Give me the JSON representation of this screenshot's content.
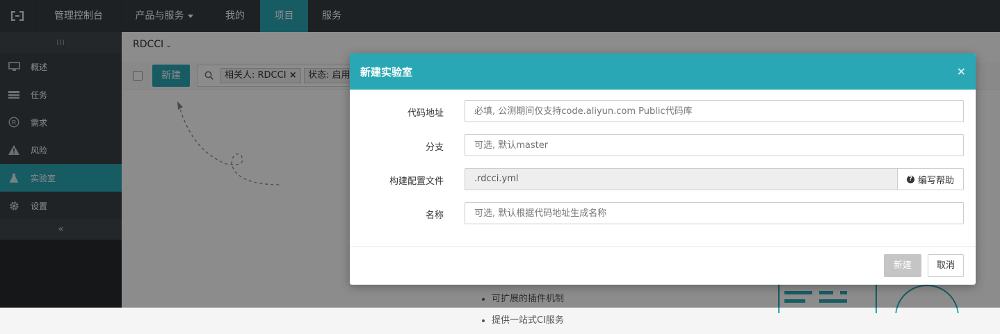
{
  "topnav": {
    "console": "管理控制台",
    "products": "产品与服务",
    "mine": "我的",
    "project": "项目",
    "service": "服务"
  },
  "sidebar": {
    "toggle": "III",
    "items": [
      {
        "label": "概述",
        "icon": "monitor-icon"
      },
      {
        "label": "任务",
        "icon": "tasks-icon"
      },
      {
        "label": "需求",
        "icon": "registered-icon"
      },
      {
        "label": "风险",
        "icon": "warning-icon"
      },
      {
        "label": "实验室",
        "icon": "flask-icon"
      },
      {
        "label": "设置",
        "icon": "gear-icon"
      }
    ],
    "collapse": "«"
  },
  "main": {
    "project_name": "RDCCI",
    "new_button": "新建",
    "filter_tags": [
      "相关人: RDCCI",
      "状态: 启用"
    ],
    "bullets": [
      "可扩展的插件机制",
      "提供一站式CI服务"
    ]
  },
  "modal": {
    "title": "新建实验室",
    "close": "×",
    "fields": {
      "repo": {
        "label": "代码地址",
        "placeholder": "必填, 公测期间仅支持code.aliyun.com Public代码库"
      },
      "branch": {
        "label": "分支",
        "placeholder": "可选, 默认master"
      },
      "config": {
        "label": "构建配置文件",
        "value": ".rdcci.yml",
        "help": "编写帮助"
      },
      "name": {
        "label": "名称",
        "placeholder": "可选, 默认根据代码地址生成名称"
      }
    },
    "buttons": {
      "create": "新建",
      "cancel": "取消"
    }
  },
  "colors": {
    "accent": "#2aa7b4",
    "nav": "#373d41",
    "sidebar": "#3a4046"
  }
}
